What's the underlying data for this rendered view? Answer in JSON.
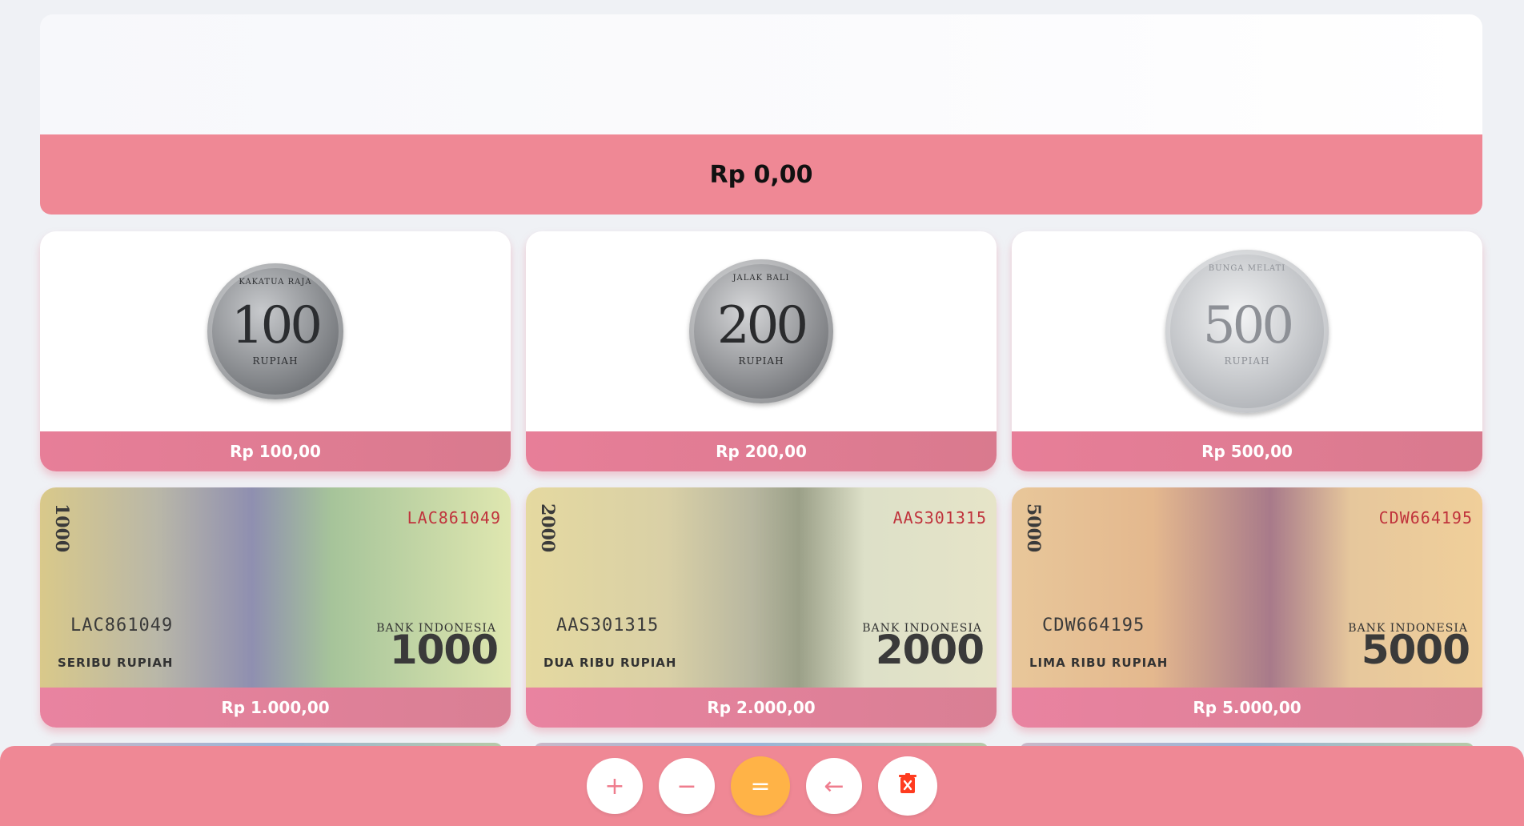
{
  "display": {
    "expression": "",
    "total": "Rp 0,00"
  },
  "denominations": [
    {
      "type": "coin",
      "label": "Rp 100,00",
      "face": "100",
      "text_top": "KAKATUA RAJA",
      "text_bottom": "RUPIAH"
    },
    {
      "type": "coin",
      "label": "Rp 200,00",
      "face": "200",
      "text_top": "JALAK BALI",
      "text_bottom": "RUPIAH"
    },
    {
      "type": "coin",
      "label": "Rp 500,00",
      "face": "500",
      "text_top": "BUNGA MELATI",
      "text_bottom": "RUPIAH"
    },
    {
      "type": "note",
      "label": "Rp 1.000,00",
      "face": "1000",
      "serial": "LAC861049",
      "words": "SERIBU RUPIAH",
      "bank": "BANK INDONESIA"
    },
    {
      "type": "note",
      "label": "Rp 2.000,00",
      "face": "2000",
      "serial": "AAS301315",
      "words": "DUA RIBU RUPIAH",
      "bank": "BANK INDONESIA"
    },
    {
      "type": "note",
      "label": "Rp 5.000,00",
      "face": "5000",
      "serial": "CDW664195",
      "words": "LIMA RIBU RUPIAH",
      "bank": "BANK INDONESIA"
    }
  ],
  "toolbar": {
    "add_symbol": "+",
    "subtract_symbol": "−",
    "equals_symbol": "=",
    "backspace_symbol": "←",
    "clear_icon": "trash-icon"
  },
  "colors": {
    "accent": "#ef8895",
    "equals": "#ffb347",
    "clear_icon": "#ff3b1f",
    "background": "#eff1f5"
  }
}
